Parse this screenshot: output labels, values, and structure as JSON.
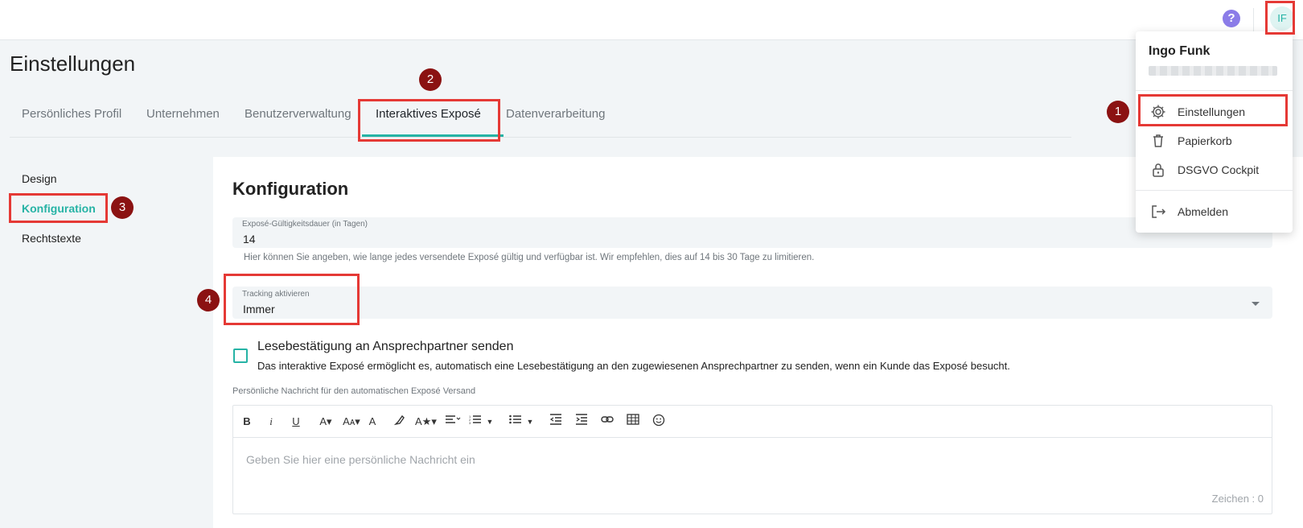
{
  "topbar": {
    "help_symbol": "?",
    "avatar_initials": "IF"
  },
  "page": {
    "title": "Einstellungen"
  },
  "tabs": [
    {
      "label": "Persönliches Profil"
    },
    {
      "label": "Unternehmen"
    },
    {
      "label": "Benutzerverwaltung"
    },
    {
      "label": "Interaktives Exposé",
      "active": true
    },
    {
      "label": "Datenverarbeitung"
    }
  ],
  "subnav": [
    {
      "label": "Design"
    },
    {
      "label": "Konfiguration",
      "active": true
    },
    {
      "label": "Rechtstexte"
    }
  ],
  "config": {
    "title": "Konfiguration",
    "validity_field": {
      "label": "Exposé-Gültigkeitsdauer (in Tagen)",
      "value": "14",
      "help": "Hier können Sie angeben, wie lange jedes versendete Exposé gültig und verfügbar ist. Wir empfehlen, dies auf 14 bis 30 Tage zu limitieren."
    },
    "tracking_field": {
      "label": "Tracking aktivieren",
      "value": "Immer"
    },
    "read_receipt": {
      "checked": false,
      "title": "Lesebestätigung an Ansprechpartner senden",
      "description": "Das interaktive Exposé ermöglicht es, automatisch eine Lesebestätigung an den zugewiesenen Ansprechpartner zu senden, wenn ein Kunde das Exposé besucht."
    },
    "message_editor": {
      "label": "Persönliche Nachricht für den automatischen Exposé Versand",
      "placeholder": "Geben Sie hier eine persönliche Nachricht ein",
      "char_count": "Zeichen : 0",
      "toolbar": {
        "bold": "B",
        "italic": "i",
        "underline": "U",
        "font_size": "A▾",
        "font_case": "Aᴀ▾",
        "font_color": "A",
        "highlight_icon": "highlighter-icon",
        "font_style": "A★▾",
        "align_icon": "align-icon",
        "ordered_list_icon": "ordered-list-icon",
        "unordered_list_icon": "unordered-list-icon",
        "outdent_icon": "outdent-icon",
        "indent_icon": "indent-icon",
        "link_icon": "link-icon",
        "table_icon": "table-icon",
        "emoji_icon": "emoji-icon"
      }
    }
  },
  "user_menu": {
    "user_name": "Ingo Funk",
    "items": [
      {
        "label": "Einstellungen",
        "icon": "gear-icon"
      },
      {
        "label": "Papierkorb",
        "icon": "trash-icon"
      },
      {
        "label": "DSGVO Cockpit",
        "icon": "lock-icon"
      },
      {
        "label": "Abmelden",
        "icon": "logout-icon"
      }
    ]
  },
  "annotations": [
    "1",
    "2",
    "3",
    "4"
  ],
  "colors": {
    "accent": "#26b3a5",
    "highlight_border": "#e53935",
    "badge": "#8b1212",
    "help": "#8b7ce8"
  }
}
